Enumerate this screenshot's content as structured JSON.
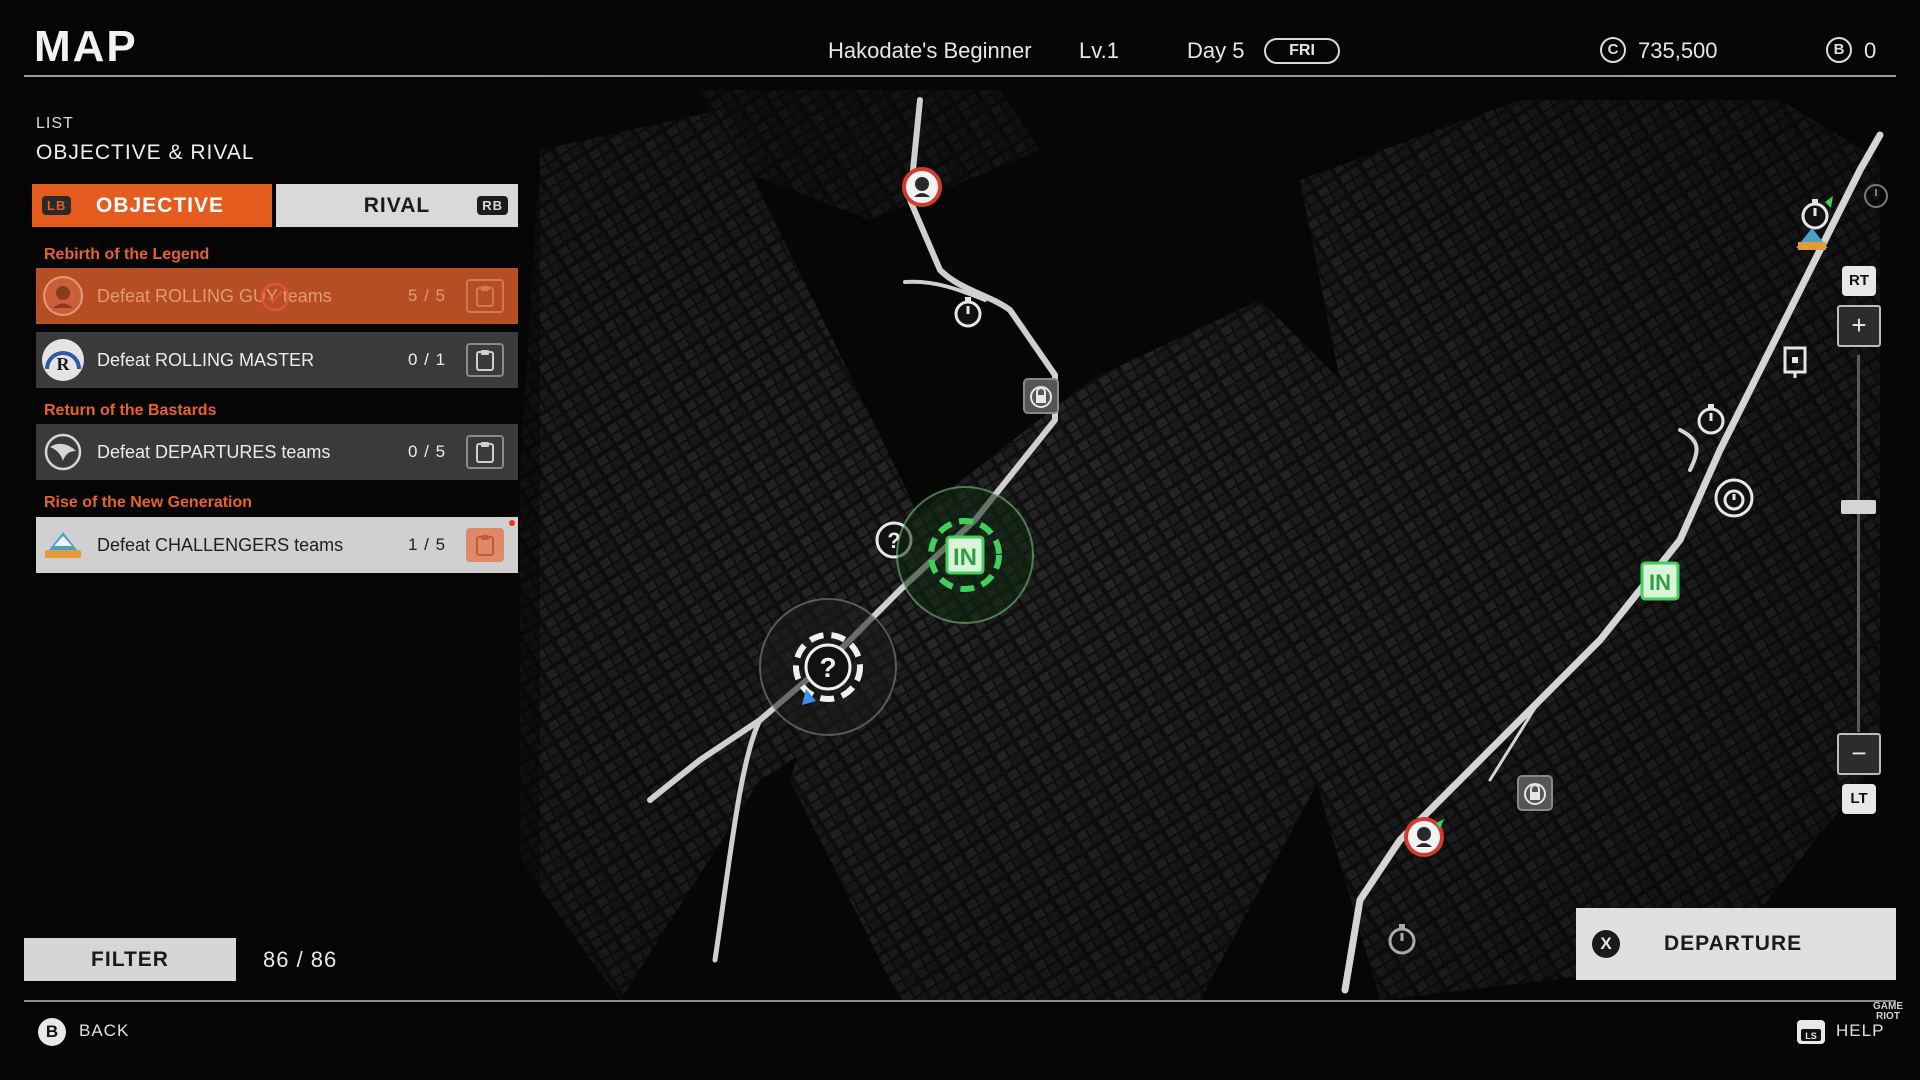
{
  "header": {
    "title": "MAP",
    "rank_name": "Hakodate's Beginner",
    "level": "Lv.1",
    "day": "Day 5",
    "weekday": "FRI",
    "credits_symbol": "C",
    "credits": "735,500",
    "b_symbol": "B",
    "b_value": "0"
  },
  "list": {
    "label": "LIST",
    "title": "OBJECTIVE & RIVAL",
    "tabs": [
      {
        "label": "OBJECTIVE",
        "button": "LB",
        "active": true
      },
      {
        "label": "RIVAL",
        "button": "RB",
        "active": false
      }
    ],
    "groups": [
      {
        "title": "Rebirth of the Legend",
        "items": [
          {
            "label": "Defeat ROLLING GUY teams",
            "count": "5 / 5",
            "state": "completed",
            "logo": "rolling-guy-logo"
          },
          {
            "label": "Defeat ROLLING MASTER",
            "count": "0 / 1",
            "state": "normal",
            "logo": "rolling-master-logo",
            "logo_text": "R"
          }
        ]
      },
      {
        "title": "Return of the Bastards",
        "items": [
          {
            "label": "Defeat DEPARTURES teams",
            "count": "0 / 5",
            "state": "normal",
            "logo": "departures-logo"
          }
        ]
      },
      {
        "title": "Rise of the New Generation",
        "items": [
          {
            "label": "Defeat CHALLENGERS teams",
            "count": "1 / 5",
            "state": "selected",
            "logo": "challengers-logo"
          }
        ]
      }
    ]
  },
  "filter": {
    "label": "FILTER",
    "count": "86 / 86"
  },
  "footer": {
    "back_button": "B",
    "back_label": "BACK",
    "help_button": "LS",
    "help_label": "HELP"
  },
  "departure": {
    "button": "X",
    "label": "DEPARTURE"
  },
  "zoom": {
    "in_key": "RT",
    "out_key": "LT",
    "plus": "+",
    "minus": "−",
    "level": 0.6
  },
  "watermark": {
    "line1": "GAME",
    "line2": "RIOT"
  },
  "map_markers": {
    "entry_label": "IN",
    "unknown_label": "?"
  },
  "colors": {
    "accent": "#e55c1f",
    "objective_title": "#e8622a",
    "completed_row": "#b64e24",
    "entry_green": "#3fcf5a",
    "road": "#cfcfcf"
  }
}
